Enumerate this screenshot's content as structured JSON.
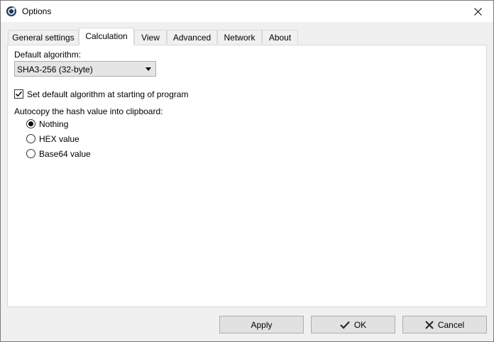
{
  "window": {
    "title": "Options"
  },
  "tabs": [
    {
      "label": "General settings"
    },
    {
      "label": "Calculation"
    },
    {
      "label": "View"
    },
    {
      "label": "Advanced"
    },
    {
      "label": "Network"
    },
    {
      "label": "About"
    }
  ],
  "active_tab": "Calculation",
  "calculation": {
    "default_algorithm_label": "Default algorithm:",
    "default_algorithm_value": "SHA3-256 (32-byte)",
    "set_default_label": "Set default algorithm at starting of program",
    "set_default_checked": true,
    "autocopy_label": "Autocopy the hash value into clipboard:",
    "autocopy_options": [
      {
        "label": "Nothing",
        "selected": true
      },
      {
        "label": "HEX value",
        "selected": false
      },
      {
        "label": "Base64 value",
        "selected": false
      }
    ]
  },
  "buttons": {
    "apply": "Apply",
    "ok": "OK",
    "cancel": "Cancel"
  },
  "colors": {
    "ok_check": "#2b2b2b",
    "cancel_x": "#2b2b2b"
  }
}
